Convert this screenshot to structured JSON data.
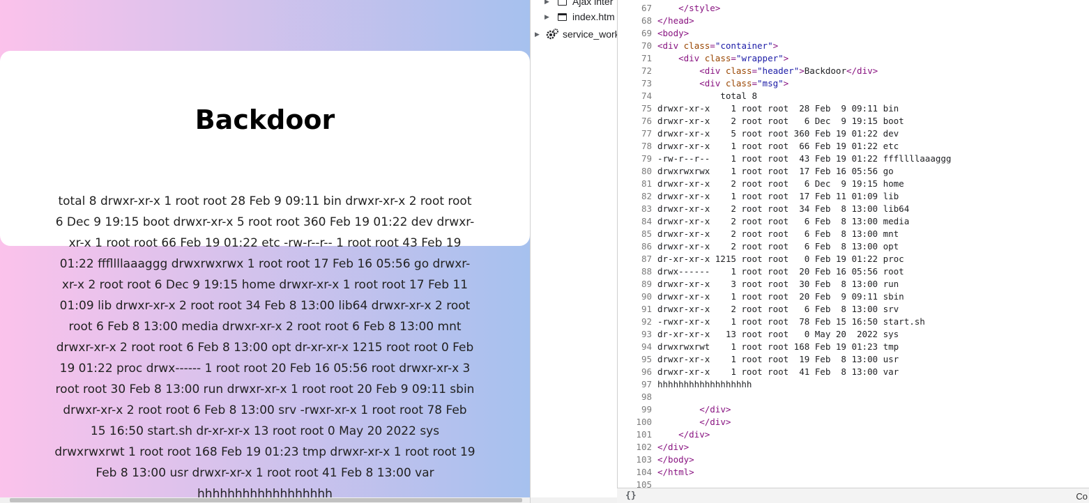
{
  "page": {
    "header": "Backdoor",
    "msg": "total 8 drwxr-xr-x 1 root root 28 Feb 9 09:11 bin drwxr-xr-x 2 root root 6 Dec 9 19:15 boot drwxr-xr-x 5 root root 360 Feb 19 01:22 dev drwxr-xr-x 1 root root 66 Feb 19 01:22 etc -rw-r--r-- 1 root root 43 Feb 19 01:22 fffllllaaaggg drwxrwxrwx 1 root root 17 Feb 16 05:56 go drwxr-xr-x 2 root root 6 Dec 9 19:15 home drwxr-xr-x 1 root root 17 Feb 11 01:09 lib drwxr-xr-x 2 root root 34 Feb 8 13:00 lib64 drwxr-xr-x 2 root root 6 Feb 8 13:00 media drwxr-xr-x 2 root root 6 Feb 8 13:00 mnt drwxr-xr-x 2 root root 6 Feb 8 13:00 opt dr-xr-xr-x 1215 root root 0 Feb 19 01:22 proc drwx------ 1 root root 20 Feb 16 05:56 root drwxr-xr-x 3 root root 30 Feb 8 13:00 run drwxr-xr-x 1 root root 20 Feb 9 09:11 sbin drwxr-xr-x 2 root root 6 Feb 8 13:00 srv -rwxr-xr-x 1 root root 78 Feb 15 16:50 start.sh dr-xr-xr-x 13 root root 0 May 20 2022 sys drwxrwxrwt 1 root root 168 Feb 19 01:23 tmp drwxr-xr-x 1 root root 19 Feb 8 13:00 usr drwxr-xr-x 1 root root 41 Feb 8 13:00 var hhhhhhhhhhhhhhhhhh"
  },
  "tree": {
    "items": [
      {
        "label": "Ajax inter",
        "icon": "frame-icon"
      },
      {
        "label": "index.htm",
        "icon": "frame-icon"
      },
      {
        "label": "service_work",
        "icon": "gear-icon"
      }
    ]
  },
  "source": {
    "lines": [
      {
        "n": "67",
        "text": "    </style>"
      },
      {
        "n": "68",
        "text": "</head>"
      },
      {
        "n": "69",
        "text": "<body>"
      },
      {
        "n": "70",
        "text": "<div class=\"container\">"
      },
      {
        "n": "71",
        "text": "    <div class=\"wrapper\">"
      },
      {
        "n": "72",
        "text": "        <div class=\"header\">Backdoor</div>"
      },
      {
        "n": "73",
        "text": "        <div class=\"msg\">"
      },
      {
        "n": "74",
        "text": "            total 8"
      },
      {
        "n": "75",
        "text": "drwxr-xr-x    1 root root  28 Feb  9 09:11 bin"
      },
      {
        "n": "76",
        "text": "drwxr-xr-x    2 root root   6 Dec  9 19:15 boot"
      },
      {
        "n": "77",
        "text": "drwxr-xr-x    5 root root 360 Feb 19 01:22 dev"
      },
      {
        "n": "78",
        "text": "drwxr-xr-x    1 root root  66 Feb 19 01:22 etc"
      },
      {
        "n": "79",
        "text": "-rw-r--r--    1 root root  43 Feb 19 01:22 fffllllaaaggg"
      },
      {
        "n": "80",
        "text": "drwxrwxrwx    1 root root  17 Feb 16 05:56 go"
      },
      {
        "n": "81",
        "text": "drwxr-xr-x    2 root root   6 Dec  9 19:15 home"
      },
      {
        "n": "82",
        "text": "drwxr-xr-x    1 root root  17 Feb 11 01:09 lib"
      },
      {
        "n": "83",
        "text": "drwxr-xr-x    2 root root  34 Feb  8 13:00 lib64"
      },
      {
        "n": "84",
        "text": "drwxr-xr-x    2 root root   6 Feb  8 13:00 media"
      },
      {
        "n": "85",
        "text": "drwxr-xr-x    2 root root   6 Feb  8 13:00 mnt"
      },
      {
        "n": "86",
        "text": "drwxr-xr-x    2 root root   6 Feb  8 13:00 opt"
      },
      {
        "n": "87",
        "text": "dr-xr-xr-x 1215 root root   0 Feb 19 01:22 proc"
      },
      {
        "n": "88",
        "text": "drwx------    1 root root  20 Feb 16 05:56 root"
      },
      {
        "n": "89",
        "text": "drwxr-xr-x    3 root root  30 Feb  8 13:00 run"
      },
      {
        "n": "90",
        "text": "drwxr-xr-x    1 root root  20 Feb  9 09:11 sbin"
      },
      {
        "n": "91",
        "text": "drwxr-xr-x    2 root root   6 Feb  8 13:00 srv"
      },
      {
        "n": "92",
        "text": "-rwxr-xr-x    1 root root  78 Feb 15 16:50 start.sh"
      },
      {
        "n": "93",
        "text": "dr-xr-xr-x   13 root root   0 May 20  2022 sys"
      },
      {
        "n": "94",
        "text": "drwxrwxrwt    1 root root 168 Feb 19 01:23 tmp"
      },
      {
        "n": "95",
        "text": "drwxr-xr-x    1 root root  19 Feb  8 13:00 usr"
      },
      {
        "n": "96",
        "text": "drwxr-xr-x    1 root root  41 Feb  8 13:00 var"
      },
      {
        "n": "97",
        "text": "hhhhhhhhhhhhhhhhhh"
      },
      {
        "n": "98",
        "text": ""
      },
      {
        "n": "99",
        "text": "        </div>"
      },
      {
        "n": "100",
        "text": "        </div>"
      },
      {
        "n": "101",
        "text": "    </div>"
      },
      {
        "n": "102",
        "text": "</div>"
      },
      {
        "n": "103",
        "text": "</body>"
      },
      {
        "n": "104",
        "text": "</html>"
      },
      {
        "n": "105",
        "text": ""
      }
    ]
  },
  "status": {
    "braces": "{}",
    "right_text": "Co"
  }
}
